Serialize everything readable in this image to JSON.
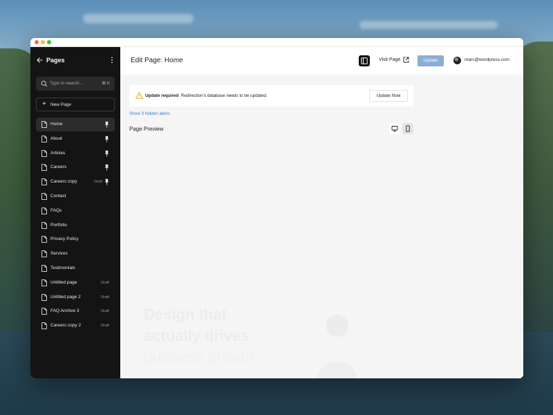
{
  "sidebar": {
    "title": "Pages",
    "search": {
      "placeholder": "Type to search...",
      "shortcut": "⌘ K"
    },
    "new_page_label": "New Page",
    "items": [
      {
        "label": "Home",
        "draft": "",
        "pinned": true,
        "active": true
      },
      {
        "label": "About",
        "draft": "",
        "pinned": true,
        "active": false
      },
      {
        "label": "Articles",
        "draft": "",
        "pinned": true,
        "active": false
      },
      {
        "label": "Careers",
        "draft": "",
        "pinned": true,
        "active": false
      },
      {
        "label": "Careers copy",
        "draft": "Draft",
        "pinned": true,
        "active": false
      },
      {
        "label": "Contact",
        "draft": "",
        "pinned": false,
        "active": false
      },
      {
        "label": "FAQs",
        "draft": "",
        "pinned": false,
        "active": false
      },
      {
        "label": "Portfolio",
        "draft": "",
        "pinned": false,
        "active": false
      },
      {
        "label": "Privacy Policy",
        "draft": "",
        "pinned": false,
        "active": false
      },
      {
        "label": "Services",
        "draft": "",
        "pinned": false,
        "active": false
      },
      {
        "label": "Testimonials",
        "draft": "",
        "pinned": false,
        "active": false
      },
      {
        "label": "Untitled page",
        "draft": "Draft",
        "pinned": false,
        "active": false
      },
      {
        "label": "Untitled page 2",
        "draft": "Draft",
        "pinned": false,
        "active": false
      },
      {
        "label": "FAQ Archive 3",
        "draft": "Draft",
        "pinned": false,
        "active": false
      },
      {
        "label": "Careers copy 2",
        "draft": "Draft",
        "pinned": false,
        "active": false
      }
    ]
  },
  "header": {
    "title": "Edit Page: Home",
    "visit_label": "Visit Page",
    "update_label": "Update",
    "user_email": "marc@wordpress.com"
  },
  "notice": {
    "title": "Update required",
    "message": "Redirection's database needs to be updated.",
    "button_label": "Update Now",
    "hidden_alerts": "Show 3 hidden alerts"
  },
  "preview": {
    "label": "Page Preview",
    "ghost_lines": [
      "Design that",
      "actually drives",
      "business growth"
    ]
  },
  "colors": {
    "sidebar_bg": "#141414",
    "update_button": "#8aaed6",
    "link": "#3a7ac0",
    "warning": "#e0b400"
  },
  "icons": {
    "back": "arrow-left-icon",
    "more": "more-vertical-icon",
    "search": "search-icon",
    "page": "document-icon",
    "pin": "pin-icon",
    "panel": "sidebar-panel-icon",
    "external": "external-link-icon",
    "warning": "warning-icon",
    "desktop": "desktop-icon",
    "mobile": "mobile-icon"
  }
}
